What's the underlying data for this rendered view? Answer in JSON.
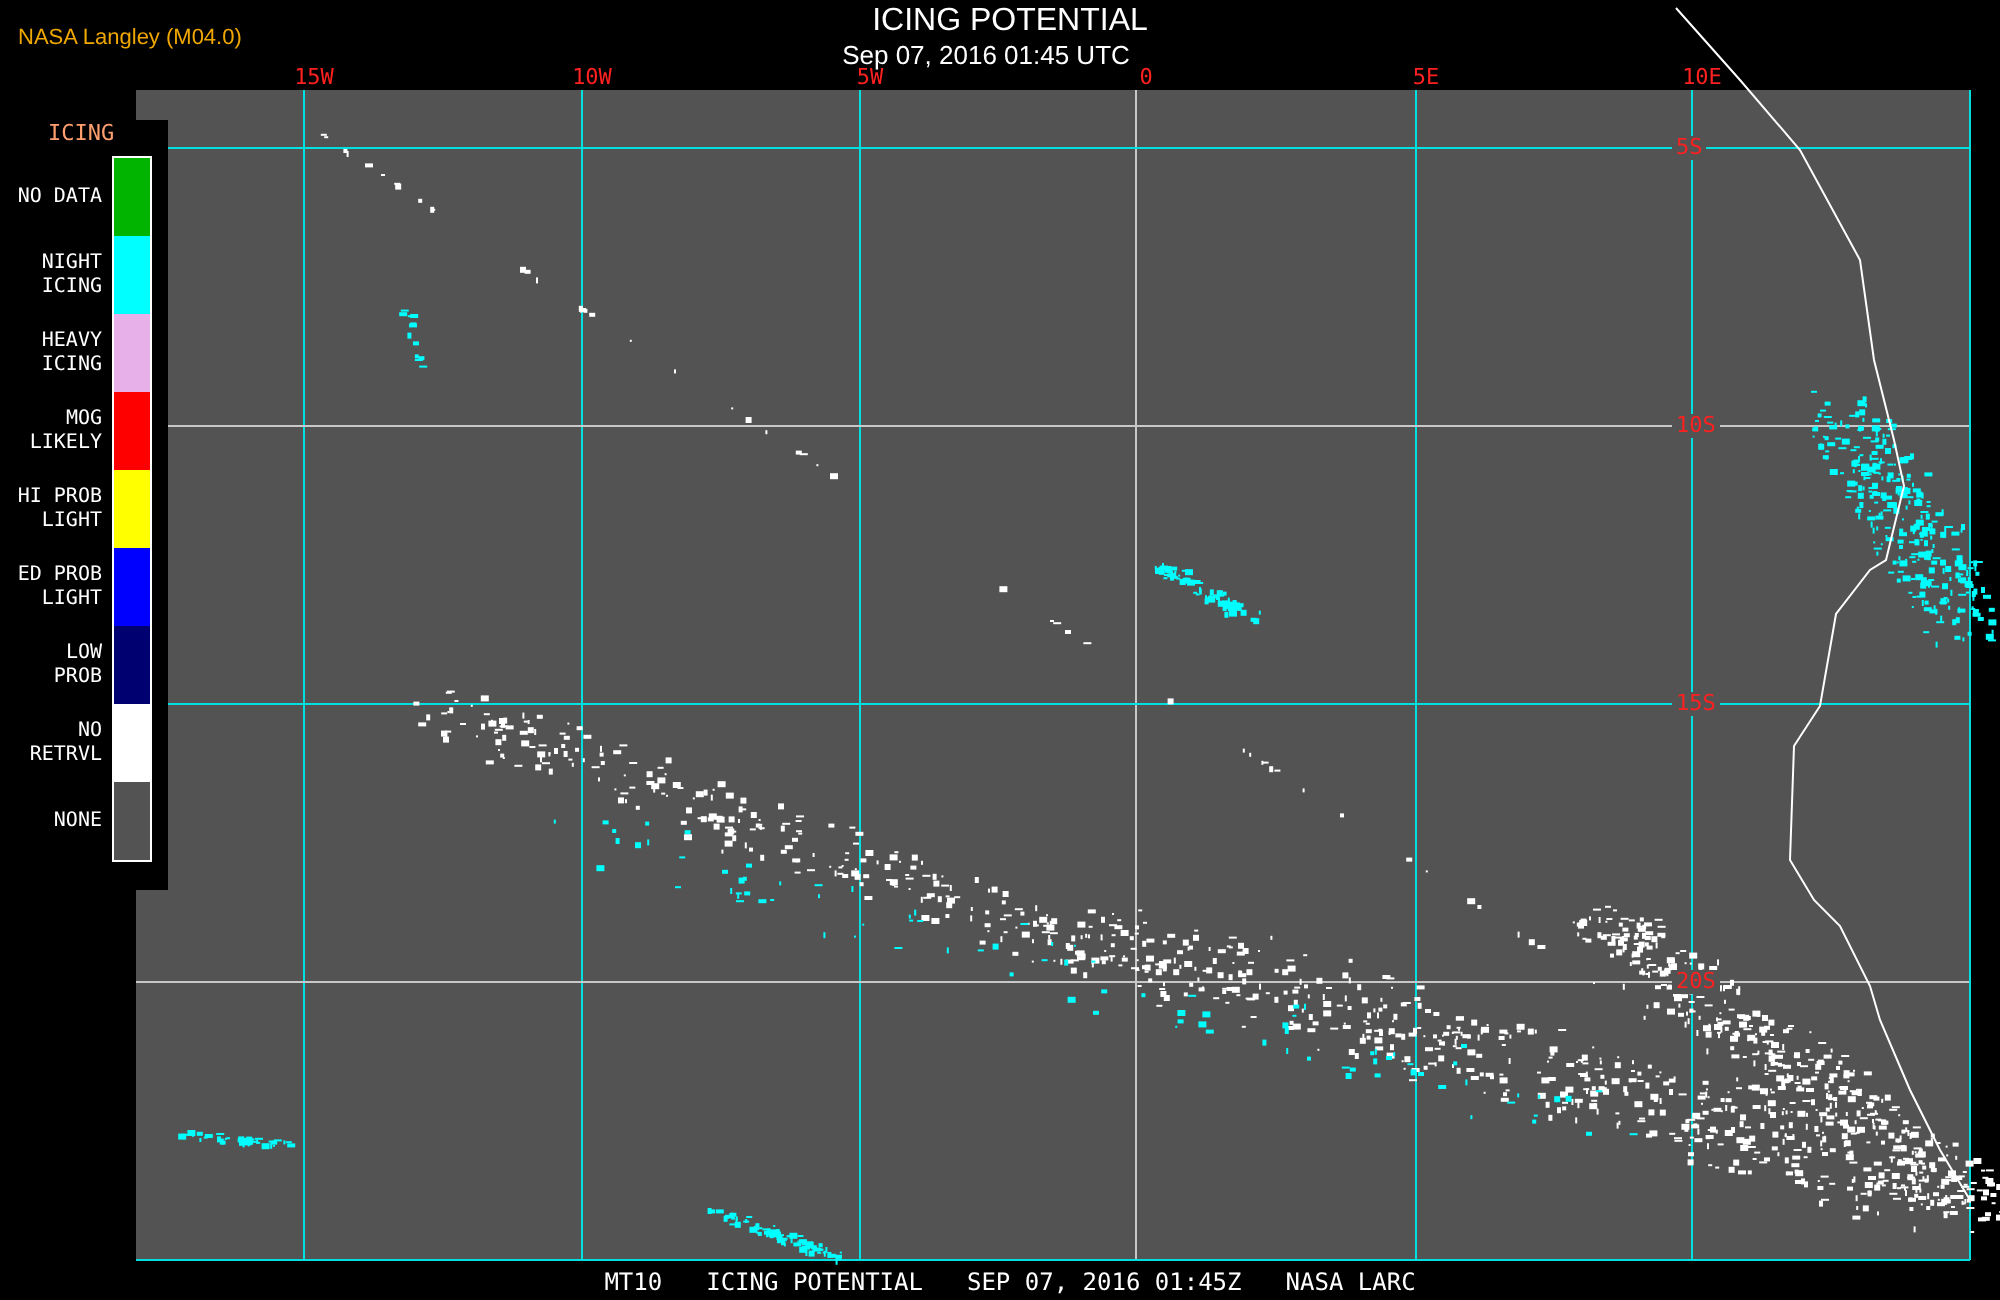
{
  "header": {
    "source": "NASA Langley (M04.0)",
    "title": "ICING POTENTIAL",
    "timestamp": "Sep 07, 2016 01:45 UTC"
  },
  "map": {
    "longitude_labels": [
      "15W",
      "10W",
      "5W",
      "0",
      "5E",
      "10E"
    ],
    "latitude_labels": [
      "5S",
      "10S",
      "15S",
      "20S"
    ]
  },
  "legend": {
    "title": "ICING",
    "items": [
      {
        "lines": [
          "NO DATA"
        ],
        "color": "#00b400"
      },
      {
        "lines": [
          "NIGHT",
          "ICING"
        ],
        "color": "#00ffff"
      },
      {
        "lines": [
          "HEAVY",
          "ICING"
        ],
        "color": "#e8b0e8"
      },
      {
        "lines": [
          "MOG",
          "LIKELY"
        ],
        "color": "#ff0000"
      },
      {
        "lines": [
          "HI PROB",
          "LIGHT"
        ],
        "color": "#ffff00"
      },
      {
        "lines": [
          "ED PROB",
          "LIGHT"
        ],
        "color": "#0000ff"
      },
      {
        "lines": [
          "LOW",
          "PROB"
        ],
        "color": "#000070"
      },
      {
        "lines": [
          "NO",
          "RETRVL"
        ],
        "color": "#ffffff"
      },
      {
        "lines": [
          "NONE"
        ],
        "color": "#535353"
      }
    ]
  },
  "footer": [
    "MT10",
    "ICING POTENTIAL",
    "SEP 07, 2016 01:45Z",
    "NASA LARC"
  ]
}
